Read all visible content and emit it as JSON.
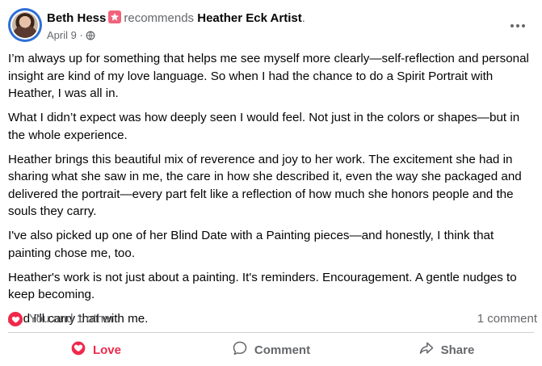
{
  "post": {
    "author": "Beth Hess",
    "verb": "recommends",
    "page_name": "Heather Eck Artist",
    "period": ".",
    "date": "April 9",
    "separator": "·",
    "paragraphs": [
      "I’m always up for something that helps me see myself more clearly—self-reflection and personal insight are kind of my love language. So when I had the chance to do a Spirit Portrait with Heather, I was all in.",
      "What I didn’t expect was how deeply seen I would feel. Not just in the colors or shapes—but in the whole experience.",
      "Heather brings this beautiful mix of reverence and joy to her work. The excitement she had in sharing what she saw in me, the care in how she described it, even the way she packaged and delivered the portrait—every part felt like a reflection of how much she honors people and the souls they carry.",
      "I've also picked up one of her Blind Date with a Painting pieces—and honestly, I think that painting chose me, too.",
      "Heather's work is not just about a painting. It's reminders. Encouragement. A gentle nudges to keep becoming.",
      "And I'll carry that with me."
    ]
  },
  "reactions": {
    "summary": "You and 1 other",
    "comments": "1 comment"
  },
  "actions": {
    "love": "Love",
    "comment": "Comment",
    "share": "Share"
  },
  "colors": {
    "love": "#f0284a",
    "badge": "#f2627b",
    "muted": "#65676b",
    "avatar_ring": "#2d6fd8"
  },
  "icons": {
    "privacy": "globe-icon",
    "more": "more-horizontal-icon",
    "reaction": "heart-icon",
    "comment": "speech-bubble-icon",
    "share": "share-arrow-icon"
  }
}
